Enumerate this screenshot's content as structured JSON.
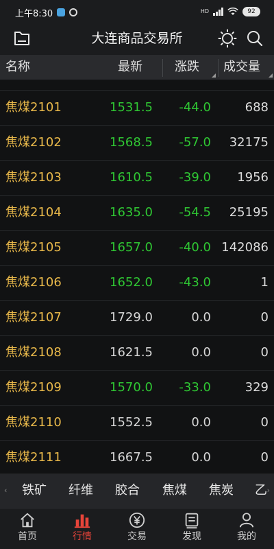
{
  "statusbar": {
    "time": "上午8:30",
    "network": "HD",
    "battery": "92"
  },
  "header": {
    "title": "大连商品交易所"
  },
  "columns": {
    "name": "名称",
    "latest": "最新",
    "change": "涨跌",
    "volume": "成交量"
  },
  "rows": [
    {
      "name": "焦煤2101",
      "latest": "1531.5",
      "change": "-44.0",
      "volume": "688",
      "trend": "down"
    },
    {
      "name": "焦煤2102",
      "latest": "1568.5",
      "change": "-57.0",
      "volume": "32175",
      "trend": "down"
    },
    {
      "name": "焦煤2103",
      "latest": "1610.5",
      "change": "-39.0",
      "volume": "1956",
      "trend": "down"
    },
    {
      "name": "焦煤2104",
      "latest": "1635.0",
      "change": "-54.5",
      "volume": "25195",
      "trend": "down"
    },
    {
      "name": "焦煤2105",
      "latest": "1657.0",
      "change": "-40.0",
      "volume": "142086",
      "trend": "down"
    },
    {
      "name": "焦煤2106",
      "latest": "1652.0",
      "change": "-43.0",
      "volume": "1",
      "trend": "down"
    },
    {
      "name": "焦煤2107",
      "latest": "1729.0",
      "change": "0.0",
      "volume": "0",
      "trend": "flat"
    },
    {
      "name": "焦煤2108",
      "latest": "1621.5",
      "change": "0.0",
      "volume": "0",
      "trend": "flat"
    },
    {
      "name": "焦煤2109",
      "latest": "1570.0",
      "change": "-33.0",
      "volume": "329",
      "trend": "down"
    },
    {
      "name": "焦煤2110",
      "latest": "1552.5",
      "change": "0.0",
      "volume": "0",
      "trend": "flat"
    },
    {
      "name": "焦煤2111",
      "latest": "1667.5",
      "change": "0.0",
      "volume": "0",
      "trend": "flat"
    }
  ],
  "categories": [
    "铁矿",
    "纤维",
    "胶合",
    "焦煤",
    "焦炭",
    "乙"
  ],
  "nav": [
    {
      "label": "首页",
      "icon": "home-icon"
    },
    {
      "label": "行情",
      "icon": "market-chart-icon"
    },
    {
      "label": "交易",
      "icon": "yen-trade-icon"
    },
    {
      "label": "发现",
      "icon": "discover-icon"
    },
    {
      "label": "我的",
      "icon": "profile-icon"
    }
  ],
  "colors": {
    "down": "#2fc733",
    "flat": "#d6d6d6",
    "name": "#e8b84a",
    "active_tab": "#e8443a"
  }
}
